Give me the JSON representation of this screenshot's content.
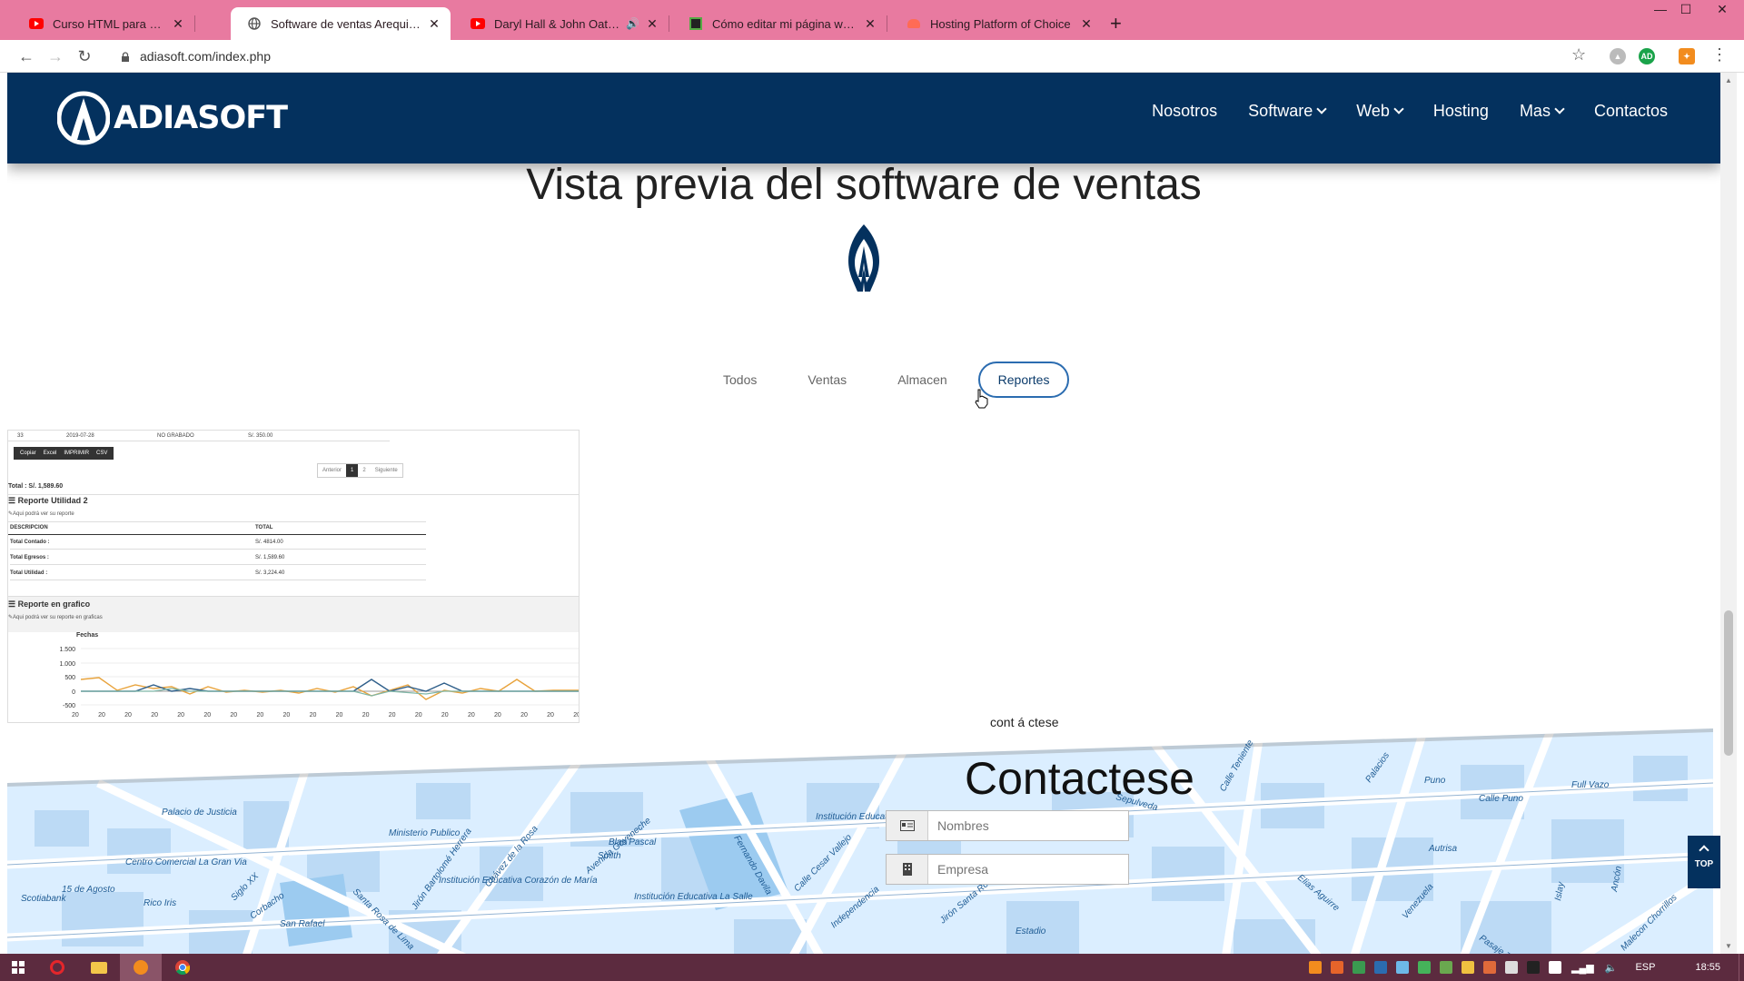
{
  "browser": {
    "tabs": [
      {
        "title": "Curso HTML para Principiantes -",
        "icon": "youtube-icon",
        "active": false
      },
      {
        "title": "Software de ventas Arequipa, ERP",
        "icon": "globe-icon",
        "active": true
      },
      {
        "title": "Daryl Hall & John Oates - M",
        "icon": "youtube-icon",
        "active": false
      },
      {
        "title": "Cómo editar mi página web con",
        "icon": "page-icon",
        "active": false
      },
      {
        "title": "Hosting Platform of Choice",
        "icon": "hosting-icon",
        "active": false
      }
    ],
    "new_tab": "+",
    "url": "adiasoft.com/index.php",
    "profile_badge": "AD"
  },
  "site": {
    "brand": "ADIASOFT",
    "nav": [
      {
        "label": "Nosotros",
        "dropdown": false
      },
      {
        "label": "Software",
        "dropdown": true
      },
      {
        "label": "Web",
        "dropdown": true
      },
      {
        "label": "Hosting",
        "dropdown": false
      },
      {
        "label": "Mas",
        "dropdown": true
      },
      {
        "label": "Contactos",
        "dropdown": false
      }
    ],
    "preview_title": "Vista previa del software de ventas",
    "filters": [
      "Todos",
      "Ventas",
      "Almacen",
      "Reportes"
    ],
    "active_filter": "Reportes",
    "report": {
      "top_row": [
        "33",
        "2019-07-28",
        "NO GRABADO",
        "S/. 350.00"
      ],
      "export_buttons": [
        "Copiar",
        "Excel",
        "IMPRIMIR",
        "CSV"
      ],
      "pagination": [
        "Anterior",
        "1",
        "2",
        "Siguiente"
      ],
      "total_line": "Total : S/. 1,589.60",
      "utilidad_title": "Reporte Utilidad 2",
      "utilidad_sub": "Aqui podrá ver su reporte",
      "table_headers": [
        "DESCRIPCION",
        "TOTAL"
      ],
      "table_rows": [
        [
          "Total Contado :",
          "S/. 4814.00"
        ],
        [
          "Total Egresos :",
          "S/. 1,589.60"
        ],
        [
          "Total Utilidad :",
          "S/. 3,224.40"
        ]
      ],
      "grafico_title": "Reporte en grafico",
      "grafico_sub": "Aqui podrá ver su reporte en graficas",
      "chart_label": "Fechas",
      "y_ticks": [
        "1.500",
        "1.000",
        "500",
        "0",
        "-500"
      ],
      "x_tick": "20"
    },
    "contact": {
      "small_text": "cont á ctese",
      "title": "Contactese",
      "fields": [
        {
          "placeholder": "Nombres",
          "icon": "id-card-icon"
        },
        {
          "placeholder": "Empresa",
          "icon": "building-icon"
        }
      ]
    },
    "top_button": "TOP",
    "map_labels": [
      "Palacio de Justicia",
      "Centro Comercial La Gran Via",
      "Ministerio Publico",
      "Jirón Bartolomé Herrera",
      "Chávez de la Rosa",
      "Avenida Goyeneche",
      "Blas Pascal",
      "Smith",
      "Institución Educativa María Montessori",
      "Fernando Davila",
      "Calle Cesar Vallejo",
      "Independencia",
      "Sepulveda",
      "Calle Teniente",
      "Palacios",
      "Puno",
      "Calle Puno",
      "Full Vazo",
      "Autrisa",
      "Venezuela",
      "Elias Aguirre",
      "Malecon Chorrillos",
      "Islay",
      "Ancón",
      "Pasaje Tenien",
      "San Rafael",
      "Scotiabank",
      "15 de Agosto",
      "Rico Iris",
      "Siglo XX",
      "Corbacho",
      "Santa Rosa de Lima",
      "Jirón Santa Rosa",
      "Institución Educativa Corazón de María",
      "Institución Educativa La Salle",
      "Estadio"
    ]
  },
  "taskbar": {
    "lang": "ESP",
    "time": "18:55"
  }
}
